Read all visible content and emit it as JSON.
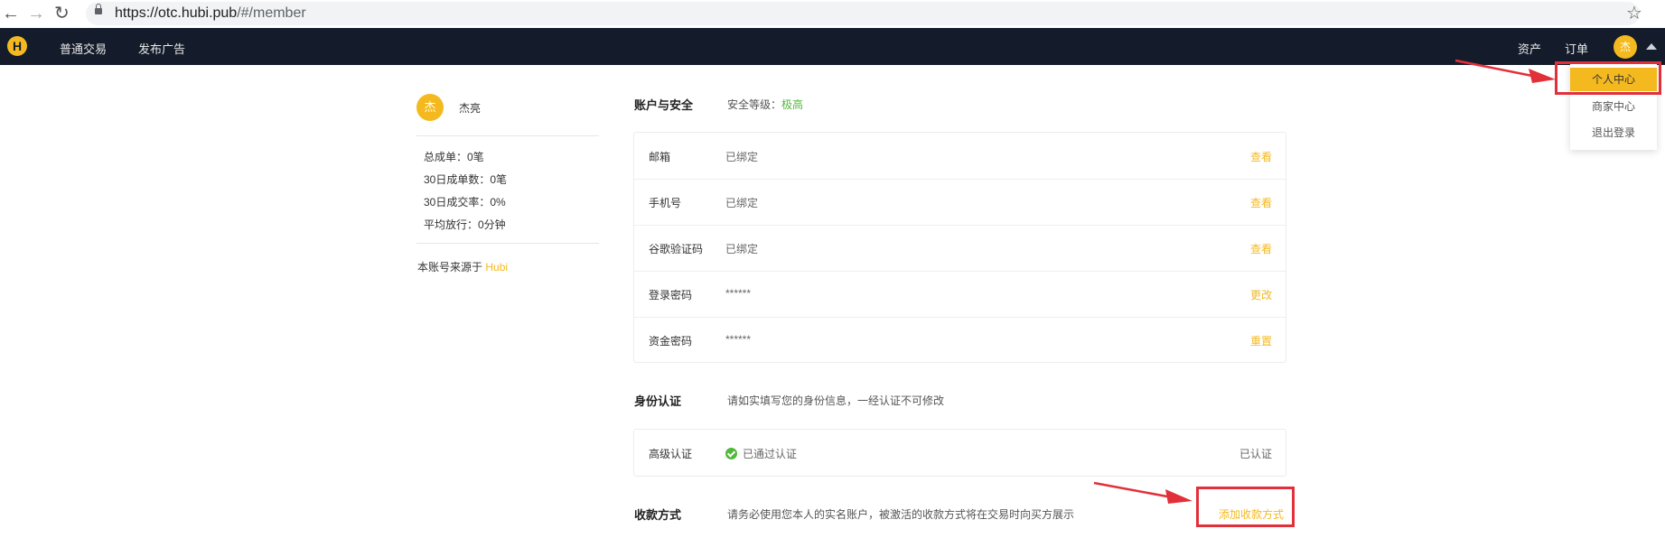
{
  "browser": {
    "url_host": "https://otc.hubi.pub",
    "url_path": "/#/member"
  },
  "header": {
    "logo": "H",
    "nav": [
      "普通交易",
      "发布广告"
    ],
    "assets": "资产",
    "orders": "订单",
    "avatar": "杰"
  },
  "dropdown": {
    "items": [
      "个人中心",
      "商家中心",
      "退出登录"
    ]
  },
  "profile": {
    "avatar": "杰",
    "name": "杰亮",
    "stats": [
      "总成单：0笔",
      "30日成单数：0笔",
      "30日成交率：0%",
      "平均放行：0分钟"
    ],
    "source_prefix": "本账号来源于",
    "source_name": "Hubi"
  },
  "security": {
    "title": "账户与安全",
    "level_label": "安全等级：",
    "level_value": "极高",
    "rows": [
      {
        "label": "邮箱",
        "value": "已绑定",
        "action": "查看"
      },
      {
        "label": "手机号",
        "value": "已绑定",
        "action": "查看"
      },
      {
        "label": "谷歌验证码",
        "value": "已绑定",
        "action": "查看"
      },
      {
        "label": "登录密码",
        "value": "******",
        "action": "更改"
      },
      {
        "label": "资金密码",
        "value": "******",
        "action": "重置"
      }
    ]
  },
  "identity": {
    "title": "身份认证",
    "desc": "请如实填写您的身份信息，一经认证不可修改",
    "row_label": "高级认证",
    "row_status": "已通过认证",
    "row_right": "已认证"
  },
  "payment": {
    "title": "收款方式",
    "desc": "请务必使用您本人的实名账户，被激活的收款方式将在交易时向买方展示",
    "add": "添加收款方式"
  },
  "colors": {
    "accent": "#f5b920",
    "header_bg": "#141c2b",
    "highlight": "#e2303a",
    "success": "#52b83a"
  }
}
